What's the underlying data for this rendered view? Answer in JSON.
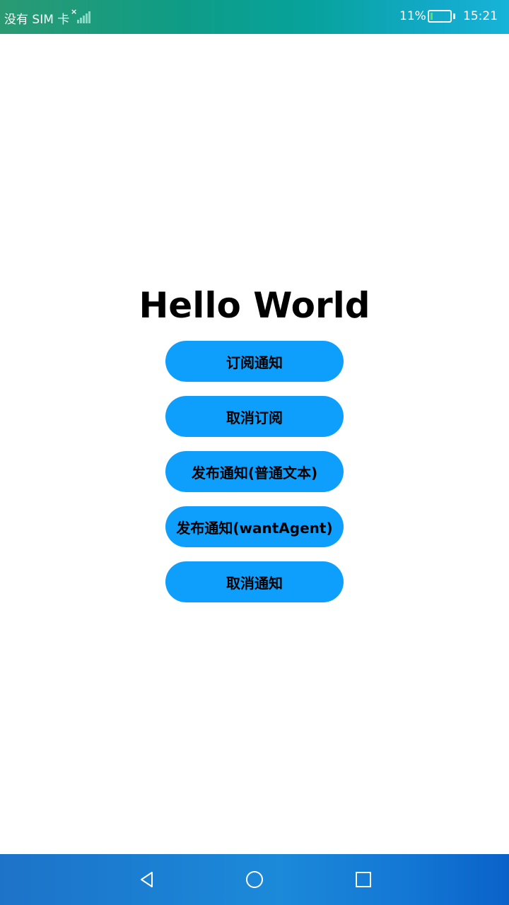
{
  "status_bar": {
    "carrier": "没有 SIM 卡",
    "battery_percent": "11%",
    "battery_level": 0.11,
    "time": "15:21"
  },
  "main": {
    "title": "Hello World",
    "buttons": [
      {
        "label": "订阅通知"
      },
      {
        "label": "取消订阅"
      },
      {
        "label": "发布通知(普通文本)"
      },
      {
        "label": "发布通知(wantAgent)"
      },
      {
        "label": "取消通知"
      }
    ]
  },
  "nav_bar": {
    "icons": [
      "back-icon",
      "home-icon",
      "recent-apps-icon"
    ]
  },
  "colors": {
    "button": "#0d9ffb",
    "battery_level": "#5be35b"
  }
}
